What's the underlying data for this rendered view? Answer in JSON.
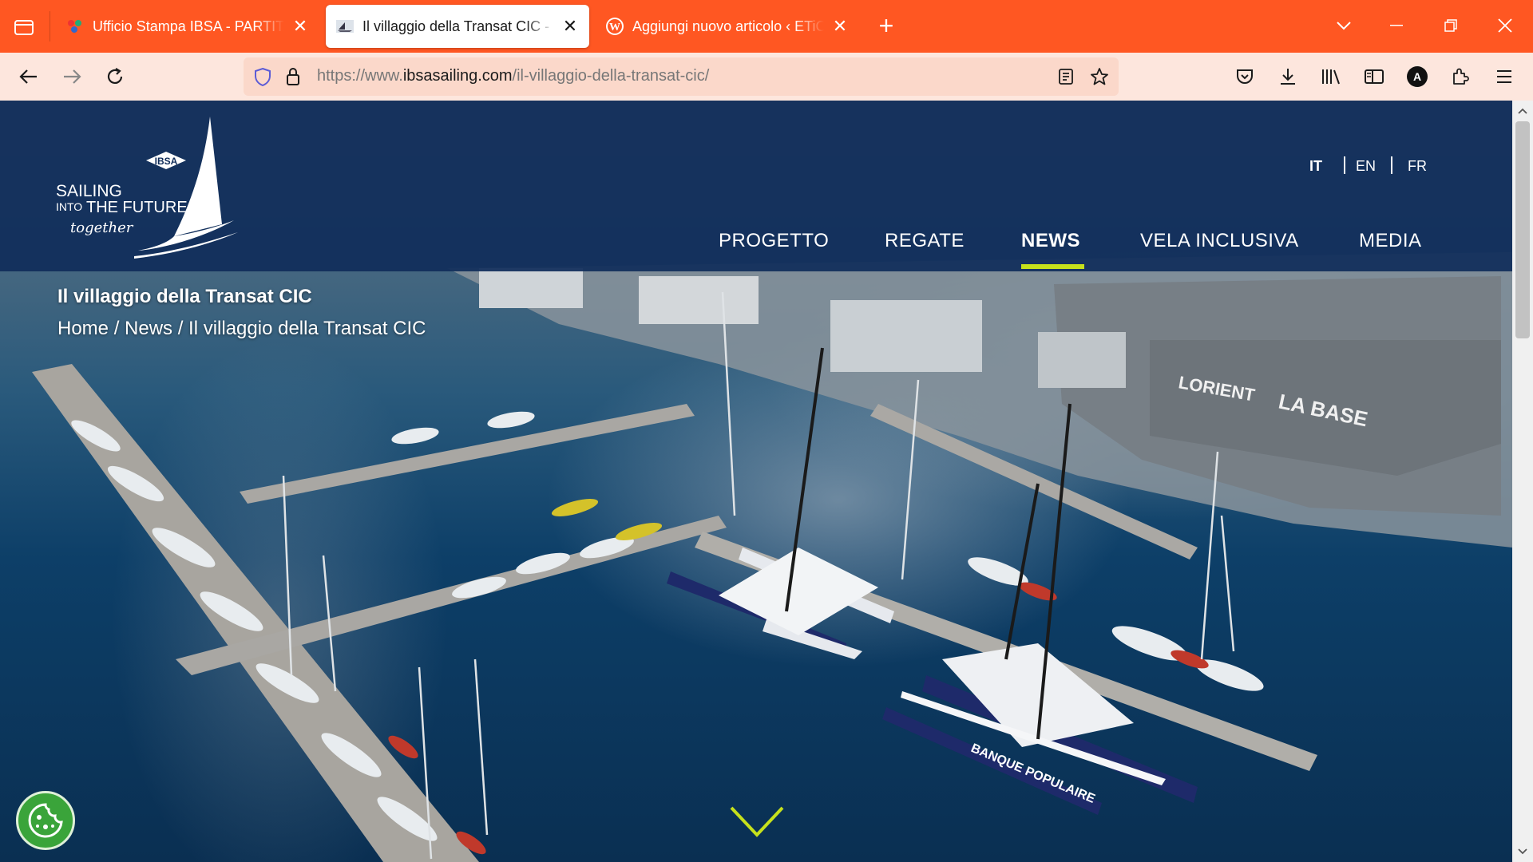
{
  "browser": {
    "tabs": [
      {
        "title": "Ufficio Stampa IBSA - PARTITA IVA",
        "active": false,
        "favicon": "colorful-logo-icon"
      },
      {
        "title": "Il villaggio della Transat CIC - IBSA",
        "active": true,
        "favicon": "sailing-photo-icon"
      },
      {
        "title": "Aggiungi nuovo articolo ‹ ETiCHETTA",
        "active": false,
        "favicon": "wordpress-icon"
      }
    ],
    "new_tab_label": "+",
    "url": {
      "prefix": "https://www.",
      "host": "ibsasailing.com",
      "path": "/il-villaggio-della-transat-cic/"
    },
    "theme_color": "#ff5722",
    "toolbar_color": "#fde6dd",
    "profile_initial": "A"
  },
  "site": {
    "logo": {
      "brand": "IBSA",
      "line1": "SAILING",
      "line2a": "INTO",
      "line2b": "THE FUTURE",
      "tagline": "together"
    },
    "languages": [
      {
        "label": "IT",
        "active": true
      },
      {
        "label": "EN",
        "active": false
      },
      {
        "label": "FR",
        "active": false
      }
    ],
    "menu": [
      {
        "label": "PROGETTO",
        "active": false
      },
      {
        "label": "REGATE",
        "active": false
      },
      {
        "label": "NEWS",
        "active": true
      },
      {
        "label": "VELA INCLUSIVA",
        "active": false
      },
      {
        "label": "MEDIA",
        "active": false
      }
    ],
    "accent_color": "#c6e11c",
    "header_color": "#102d5a"
  },
  "hero": {
    "title": "Il villaggio della Transat CIC",
    "breadcrumb": "Home / News / Il villaggio della Transat CIC",
    "sign_lorient": "LORIENT",
    "sign_base": "LA BASE",
    "hull_text": "BANQUE POPULAIRE"
  }
}
